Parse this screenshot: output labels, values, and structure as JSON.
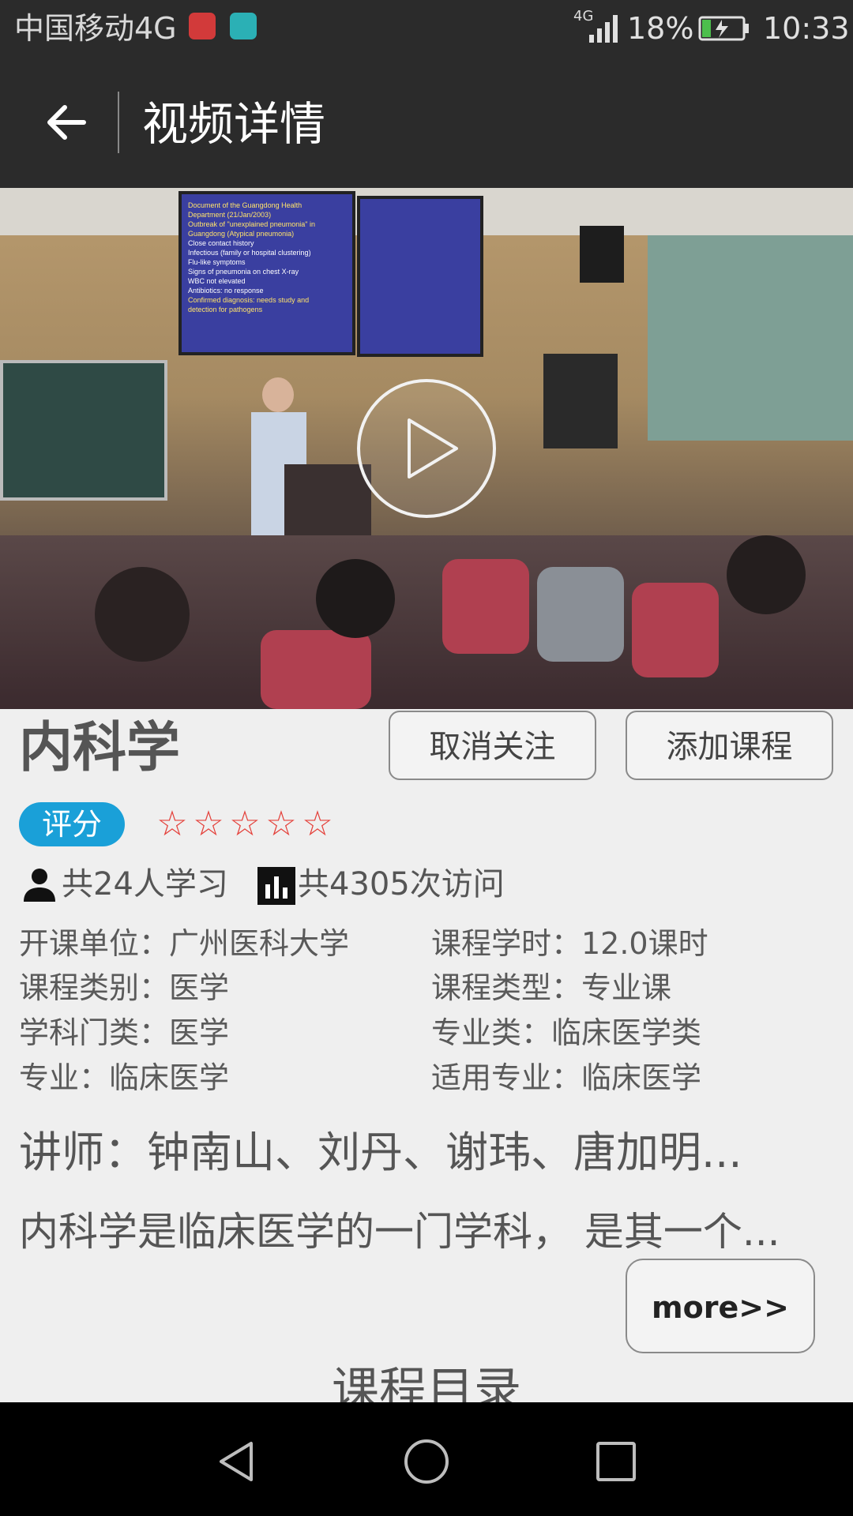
{
  "status_bar": {
    "carrier": "中国移动4G",
    "network_type": "4G",
    "battery_percent": "18%",
    "time": "10:33",
    "icons": [
      "huawei-app-icon",
      "android-app-icon",
      "signal-icon",
      "battery-charging-icon"
    ]
  },
  "header": {
    "back_icon": "arrow-left-icon",
    "title": "视频详情"
  },
  "video": {
    "play_icon": "play-icon",
    "slide_left_lines": [
      "Document of the Guangdong Health",
      "Department (21/Jan/2003)",
      "Outbreak of \"unexplained pneumonia\" in",
      "Guangdong (Atypical pneumonia)",
      "Close contact history",
      "Infectious (family or hospital clustering)",
      "Flu-like symptoms",
      "Signs of pneumonia on chest X-ray",
      "WBC not elevated",
      "Antibiotics: no response",
      "Confirmed diagnosis: needs study and",
      "detection for pathogens"
    ]
  },
  "course": {
    "title": "内科学",
    "unfollow_label": "取消关注",
    "add_course_label": "添加课程",
    "rating_label": "评分",
    "rating_stars_filled": 0,
    "rating_stars_total": 5,
    "star_char": "☆",
    "learners": "共24人学习",
    "visits": "共4305次访问",
    "info_left": [
      "开课单位：广州医科大学",
      "课程类别：医学",
      "学科门类：医学",
      "专业：临床医学"
    ],
    "info_right": [
      "课程学时：12.0课时",
      "课程类型：专业课",
      "专业类：临床医学类",
      "适用专业：临床医学"
    ],
    "instructors": "讲师：钟南山、刘丹、谢玮、唐加明...",
    "description": "内科学是临床医学的一门学科， 是其一个...",
    "more_label": "more>>",
    "catalog_heading": "课程目录"
  },
  "nav_bar": {
    "icons": [
      "nav-back-icon",
      "nav-home-icon",
      "nav-recent-icon"
    ]
  },
  "colors": {
    "bar_dark": "#2b2b2b",
    "accent_blue": "#1aa0d8",
    "star_red": "#e4403a",
    "page_bg": "#efefef"
  }
}
